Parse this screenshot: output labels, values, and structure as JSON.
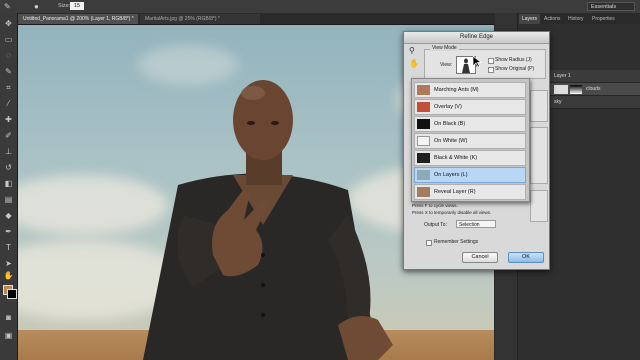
{
  "options_bar": {
    "size_label": "Size:",
    "size_value": "15",
    "workspace": "Essentials"
  },
  "tabs": [
    {
      "label": "Untitled_Panorama1 @ 200% (Layer 1, RGB/8*) *"
    },
    {
      "label": "MartialArts.jpg @ 25% (RGB/8*) *"
    }
  ],
  "right_panel": {
    "tabs": [
      "Layers",
      "Actions",
      "History",
      "Properties"
    ],
    "layers": [
      "Layer 1",
      "clouds",
      "sky"
    ]
  },
  "dialog": {
    "title": "Refine Edge",
    "view_mode_label": "View Mode",
    "view_label": "View:",
    "show_radius": "Show Radius (J)",
    "show_original": "Show Original (P)",
    "menu_items": [
      {
        "label": "Marching Ants (M)",
        "thumb_color": "#b07a5a",
        "selected": false
      },
      {
        "label": "Overlay (V)",
        "thumb_color": "#c0503c",
        "selected": false
      },
      {
        "label": "On Black (B)",
        "thumb_color": "#111111",
        "selected": false
      },
      {
        "label": "On White (W)",
        "thumb_color": "#f4f4f4",
        "selected": false
      },
      {
        "label": "Black & White (K)",
        "thumb_color": "#202020",
        "selected": false
      },
      {
        "label": "On Layers (L)",
        "thumb_color": "#8fa9b5",
        "selected": true
      },
      {
        "label": "Reveal Layer (R)",
        "thumb_color": "#a57c62",
        "selected": false
      }
    ],
    "hint1": "Press F to cycle views.",
    "hint2": "Press X to temporarily disable all views.",
    "output_to_label": "Output To:",
    "output_to_value": "Selection",
    "remember_settings": "Remember Settings",
    "cancel": "Cancel",
    "ok": "OK"
  }
}
